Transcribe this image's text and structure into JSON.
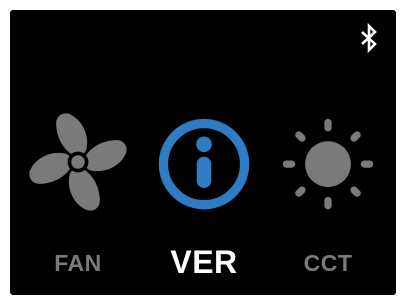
{
  "colors": {
    "background": "#000000",
    "inactive": "#7a7a7a",
    "active_icon": "#2f7cc4",
    "active_label": "#ffffff",
    "status_icon": "#ffffff"
  },
  "status_bar": {
    "bluetooth_icon": "bluetooth-icon"
  },
  "menu": {
    "selected": "VER",
    "items": [
      {
        "label": "FAN",
        "icon": "fan-icon",
        "active": false
      },
      {
        "label": "VER",
        "icon": "info-icon",
        "active": true
      },
      {
        "label": "CCT",
        "icon": "sun-icon",
        "active": false
      }
    ]
  }
}
